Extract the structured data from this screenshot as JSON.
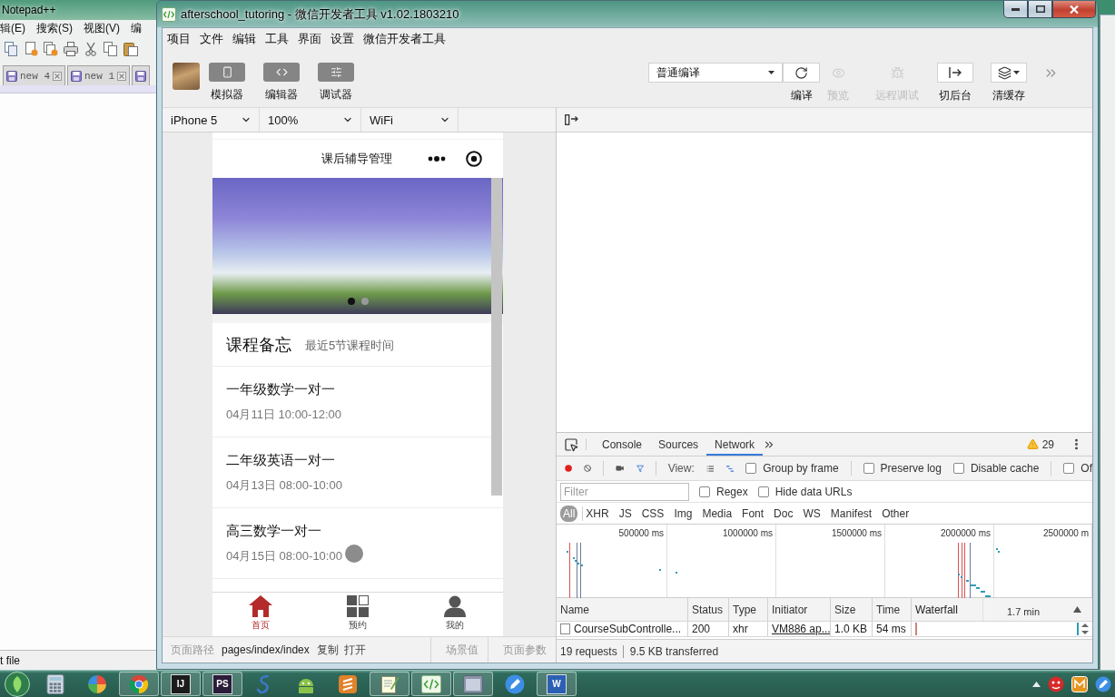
{
  "notepad": {
    "title": "Notepad++",
    "menus": [
      "辑(E)",
      "搜索(S)",
      "视图(V)",
      "编"
    ],
    "tabs": [
      {
        "kind": "tab",
        "label": "new 4"
      },
      {
        "kind": "tab",
        "label": "new 1"
      },
      {
        "kind": "stub"
      }
    ],
    "status": "t file"
  },
  "window": {
    "title": "afterschool_tutoring - 微信开发者工具 v1.02.1803210"
  },
  "menu": [
    "项目",
    "文件",
    "编辑",
    "工具",
    "界面",
    "设置",
    "微信开发者工具"
  ],
  "toolbar": {
    "views": [
      {
        "kind": "simulator",
        "label": "模拟器"
      },
      {
        "kind": "editor",
        "label": "编辑器"
      },
      {
        "kind": "debugger",
        "label": "调试器"
      }
    ],
    "compile_mode": "普通编译",
    "actions": [
      {
        "kind": "compile",
        "label": "编译",
        "disabled": false
      },
      {
        "kind": "preview",
        "label": "预览",
        "disabled": true
      },
      {
        "kind": "remote_debug",
        "label": "远程调试",
        "disabled": true
      },
      {
        "kind": "background",
        "label": "切后台",
        "disabled": false
      },
      {
        "kind": "clear_cache",
        "label": "清缓存",
        "disabled": false
      }
    ]
  },
  "device_bar": {
    "selects": [
      "iPhone 5",
      "100%",
      "WiFi"
    ]
  },
  "simulator": {
    "nav_title": "课后辅导管理",
    "swiper_dots": [
      {
        "selected": true
      },
      {
        "selected": false
      }
    ],
    "section": {
      "title": "课程备忘",
      "subtitle": "最近5节课程时间"
    },
    "courses": [
      {
        "title": "一年级数学一对一",
        "time": "04月11日 10:00-12:00"
      },
      {
        "title": "二年级英语一对一",
        "time": "04月13日 08:00-10:00"
      },
      {
        "title": "高三数学一对一",
        "time": "04月15日 08:00-10:00"
      }
    ],
    "tab_bar": [
      {
        "kind": "home",
        "label": "首页",
        "selected": true
      },
      {
        "kind": "booking",
        "label": "预约",
        "selected": false
      },
      {
        "kind": "profile",
        "label": "我的",
        "selected": false
      }
    ]
  },
  "status_bar": {
    "path_label": "页面路径",
    "path": "pages/index/index",
    "actions": [
      "复制",
      "打开"
    ],
    "scene": "场景值",
    "params": "页面参数"
  },
  "devtools": {
    "tabs": [
      {
        "label": "Console",
        "selected": false
      },
      {
        "label": "Sources",
        "selected": false
      },
      {
        "label": "Network",
        "selected": true
      }
    ],
    "warnings": "29",
    "recording": true,
    "view_label": "View:",
    "views": [
      {
        "kind": "list",
        "selected": false
      },
      {
        "kind": "waterfall",
        "selected": true
      }
    ],
    "options": [
      {
        "label": "Group by frame",
        "checked": false
      },
      {
        "label": "Preserve log",
        "checked": false
      },
      {
        "label": "Disable cache",
        "checked": false
      },
      {
        "label": "Of",
        "checked": false
      }
    ],
    "filter": {
      "placeholder": "Filter",
      "options": [
        {
          "label": "Regex",
          "checked": false
        },
        {
          "label": "Hide data URLs",
          "checked": false
        }
      ]
    },
    "types": [
      {
        "label": "All",
        "selected": true
      },
      {
        "label": "XHR",
        "selected": false
      },
      {
        "label": "JS",
        "selected": false
      },
      {
        "label": "CSS",
        "selected": false
      },
      {
        "label": "Img",
        "selected": false
      },
      {
        "label": "Media",
        "selected": false
      },
      {
        "label": "Font",
        "selected": false
      },
      {
        "label": "Doc",
        "selected": false
      },
      {
        "label": "WS",
        "selected": false
      },
      {
        "label": "Manifest",
        "selected": false
      },
      {
        "label": "Other",
        "selected": false
      }
    ],
    "overview": {
      "ticks": [
        "500000 ms",
        "1000000 ms",
        "1500000 ms",
        "2000000 ms",
        "2500000 m"
      ]
    },
    "table": {
      "columns": [
        "Name",
        "Status",
        "Type",
        "Initiator",
        "Size",
        "Time",
        "Waterfall"
      ],
      "waterfall_scale": "1.7 min",
      "rows": [
        {
          "name": "CourseSubControlle...",
          "status": "200",
          "type": "xhr",
          "initiator": "VM886 ap...",
          "size": "1.0 KB",
          "time": "54 ms"
        }
      ]
    },
    "summary": [
      "19 requests",
      "9.5 KB transferred"
    ]
  },
  "taskbar": {
    "items": [
      {
        "kind": "start"
      },
      {
        "kind": "calculator",
        "open": false
      },
      {
        "kind": "pinwheel",
        "open": false
      },
      {
        "kind": "tricolor",
        "open": true
      },
      {
        "kind": "tile",
        "label": "IJ",
        "color": "#1b1b1b",
        "open": true
      },
      {
        "kind": "tile",
        "label": "PS",
        "color": "#2a1d3a",
        "open": true
      },
      {
        "kind": "swirl",
        "open": false
      },
      {
        "kind": "robot",
        "open": false
      },
      {
        "kind": "zigzag",
        "open": false
      },
      {
        "kind": "notepad",
        "open": true
      },
      {
        "kind": "code",
        "open": true
      },
      {
        "kind": "window",
        "open": true
      },
      {
        "kind": "pen",
        "open": false
      },
      {
        "kind": "tile",
        "label": "W",
        "color": "#2b5fb4",
        "open": true
      }
    ],
    "tray": [
      {
        "kind": "arrow"
      },
      {
        "kind": "face"
      },
      {
        "kind": "app"
      },
      {
        "kind": "pen"
      }
    ]
  }
}
